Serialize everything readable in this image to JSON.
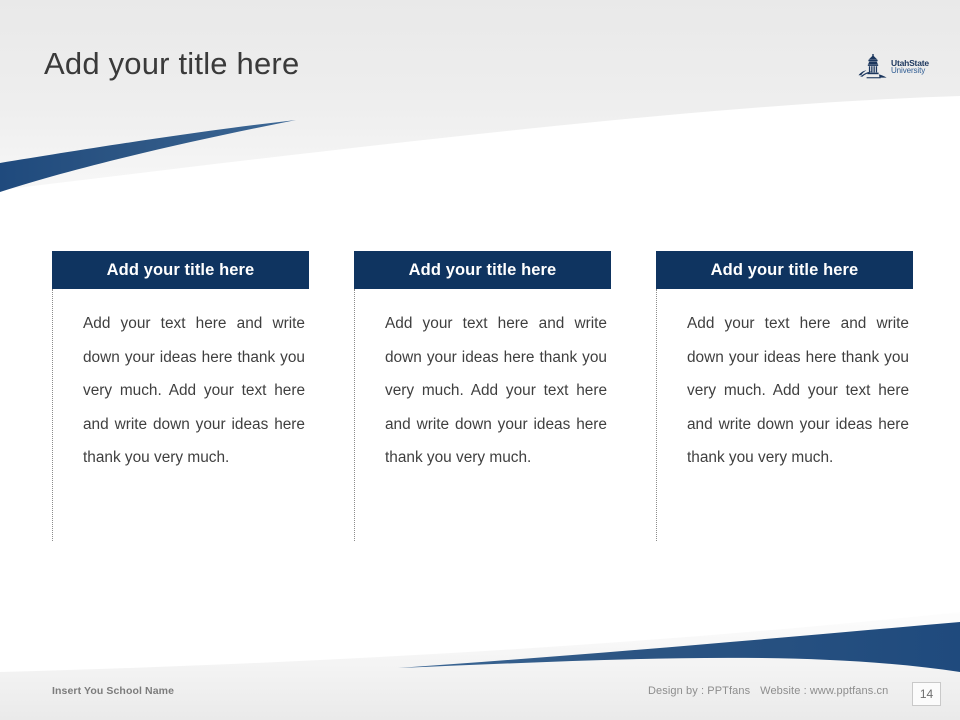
{
  "slide": {
    "title": "Add your title here",
    "accent_color": "#0f3460",
    "title_color": "#3a3a3a",
    "background_color": "#ffffff"
  },
  "logo": {
    "name": "utah-state-university-logo",
    "line1": "UtahState",
    "line2": "University",
    "color": "#1b365d"
  },
  "cards": [
    {
      "header": "Add your title here",
      "body": "Add your text here and write down your ideas here thank you very much. Add your text here and write down your ideas here thank you very much."
    },
    {
      "header": "Add your title here",
      "body": "Add your text here and write down your ideas here thank you very much. Add your text here and write down your ideas here thank you very much."
    },
    {
      "header": "Add your title here",
      "body": "Add your text here and write down your ideas here thank you very much. Add your text here and write down your ideas here thank you very much."
    }
  ],
  "footer": {
    "school_name": "Insert You School Name",
    "design_by": "Design by : PPTfans",
    "website": "Website : www.pptfans.cn",
    "page_number": "14"
  }
}
